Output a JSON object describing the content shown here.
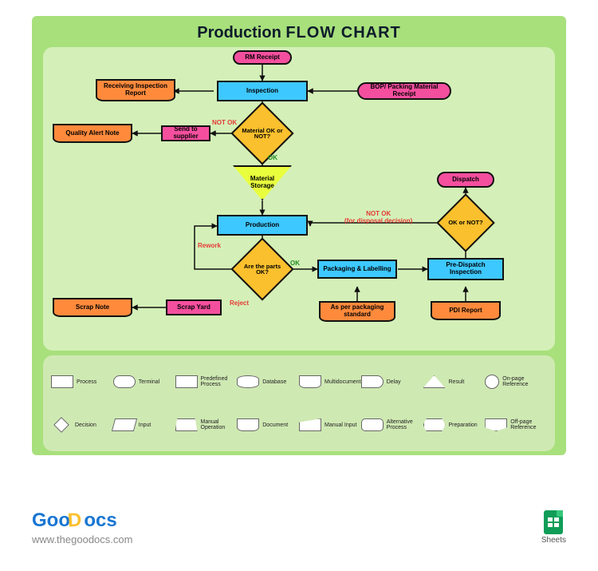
{
  "title": {
    "t1": "Production ",
    "t2": "FLOW CHART"
  },
  "nodes": {
    "rm_receipt": "RM Receipt",
    "inspection": "Inspection",
    "bop_receipt": "BOP/ Packing Material Receipt",
    "receiving_report": "Receiving Inspection Report",
    "material_ok": "Material OK or NOT?",
    "send_supplier": "Send to supplier",
    "quality_alert": "Quality Alert Note",
    "material_storage": "Material Storage",
    "production": "Production",
    "parts_ok": "Are the parts OK?",
    "packaging": "Packaging & Labelling",
    "pre_dispatch": "Pre-Dispatch Inspection",
    "ok_or_not": "OK or NOT?",
    "dispatch": "Dispatch",
    "scrap_yard": "Scrap Yard",
    "scrap_note": "Scrap Note",
    "packaging_std": "As per packaging standard",
    "pdi_report": "PDI Report"
  },
  "edges": {
    "not_ok_1": "NOT OK",
    "ok_1": "OK",
    "rework": "Rework",
    "ok_2": "OK",
    "reject": "Reject",
    "not_ok_disposal": "NOT OK\n(for disposal decision)"
  },
  "legend": {
    "row1": [
      "Process",
      "Terminal",
      "Predefined Process",
      "Database",
      "Multidocument",
      "Delay",
      "Result",
      "On-page Reference"
    ],
    "row2": [
      "Decision",
      "Input",
      "Manual Operation",
      "Document",
      "Manual Input",
      "Alternative Process",
      "Preparation",
      "Off-page Reference"
    ]
  },
  "brand": {
    "name1": "Goo",
    "name2": "D",
    "name3": "ocs",
    "url": "www.thegoodocs.com"
  },
  "sheets_label": "Sheets"
}
